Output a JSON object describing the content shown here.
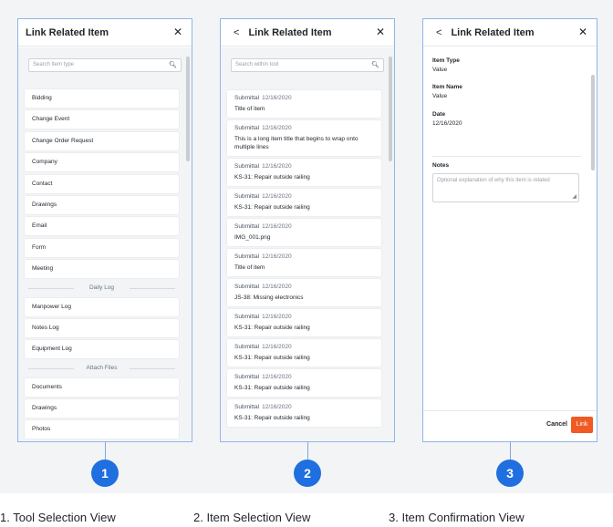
{
  "colors": {
    "accent": "#1f6fe0",
    "link_button": "#f15a22",
    "panel_border": "#8fb6e8"
  },
  "tool_view": {
    "title": "Link Related Item",
    "close_icon": "close-icon",
    "search_placeholder": "Search item type",
    "items": [
      "Bidding",
      "Change Event",
      "Change Order Request",
      "Company",
      "Contact",
      "Drawings",
      "Email",
      "Form",
      "Meeting"
    ],
    "daily_log": {
      "header": "Daily Log",
      "items": [
        "Manpower Log",
        "Notes Log",
        "Equipment Log"
      ]
    },
    "attach_files": {
      "header": "Attach Files",
      "items": [
        "Documents",
        "Drawings",
        "Photos"
      ]
    }
  },
  "item_view": {
    "title": "Link Related Item",
    "search_placeholder": "Search within tool",
    "items": [
      {
        "type": "Submittal",
        "date": "12/16/2020",
        "title": "Title of item"
      },
      {
        "type": "Submittal",
        "date": "12/16/2020",
        "title": "This is a long item title that begins to wrap onto multiple lines"
      },
      {
        "type": "Submittal",
        "date": "12/16/2020",
        "title": "KS-31: Repair outside railing"
      },
      {
        "type": "Submittal",
        "date": "12/16/2020",
        "title": "KS-31: Repair outside railing"
      },
      {
        "type": "Submittal",
        "date": "12/16/2020",
        "title": "IMG_001.png"
      },
      {
        "type": "Submittal",
        "date": "12/16/2020",
        "title": "Title of item"
      },
      {
        "type": "Submittal",
        "date": "12/16/2020",
        "title": "JS-38: Missing electronics"
      },
      {
        "type": "Submittal",
        "date": "12/16/2020",
        "title": "KS-31: Repair outside railing"
      },
      {
        "type": "Submittal",
        "date": "12/16/2020",
        "title": "KS-31: Repair outside railing"
      },
      {
        "type": "Submittal",
        "date": "12/16/2020",
        "title": "KS-31: Repair outside railing"
      },
      {
        "type": "Submittal",
        "date": "12/16/2020",
        "title": "KS-31: Repair outside railing"
      }
    ]
  },
  "confirm_view": {
    "title": "Link Related Item",
    "item_type_label": "Item Type",
    "item_type_value": "Value",
    "item_name_label": "Item Name",
    "item_name_value": "Value",
    "date_label": "Date",
    "date_value": "12/16/2020",
    "notes_label": "Notes",
    "notes_placeholder": "Optional explanation of why this item is related",
    "cancel_label": "Cancel",
    "link_label": "Link"
  },
  "badges": [
    "1",
    "2",
    "3"
  ],
  "captions": [
    "1. Tool Selection View",
    "2. Item Selection View",
    "3. Item Confirmation View"
  ]
}
